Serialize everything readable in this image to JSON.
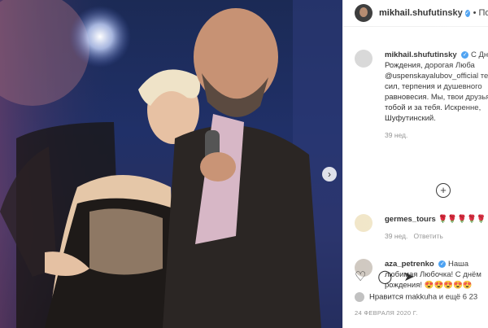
{
  "post_author": {
    "username": "mikhail.shufutinsky",
    "follow_text": "Под"
  },
  "comments": [
    {
      "username": "mikhail.shufutinsky",
      "text": "С Днём Рождения, дорогая Люба @uspenskayalubov_official тебе сил, терпения и душевного равновесия. Мы, твои друзья, с тобой и за тебя. Искренне, Шуфутинский.",
      "time": "39 нед."
    },
    {
      "username": "germes_tours",
      "text": "🌹🌹🌹🌹🌹",
      "time": "39 нед.",
      "reply": "Ответить"
    },
    {
      "username": "aza_petrenko",
      "text": "Наша любимая Любочка! С днём рождения! 😍😍😍😍😍"
    }
  ],
  "likes_text": "Нравится makkuha и ещё 6 23",
  "date_text": "24 ФЕВРАЛЯ 2020 Г.",
  "icons": [
    "heart-icon",
    "comment-icon",
    "share-icon",
    "plus-icon",
    "chevron-right-icon"
  ],
  "colors": {
    "verified": "#3897f0",
    "text": "#262626",
    "muted": "#8e8e8e"
  }
}
